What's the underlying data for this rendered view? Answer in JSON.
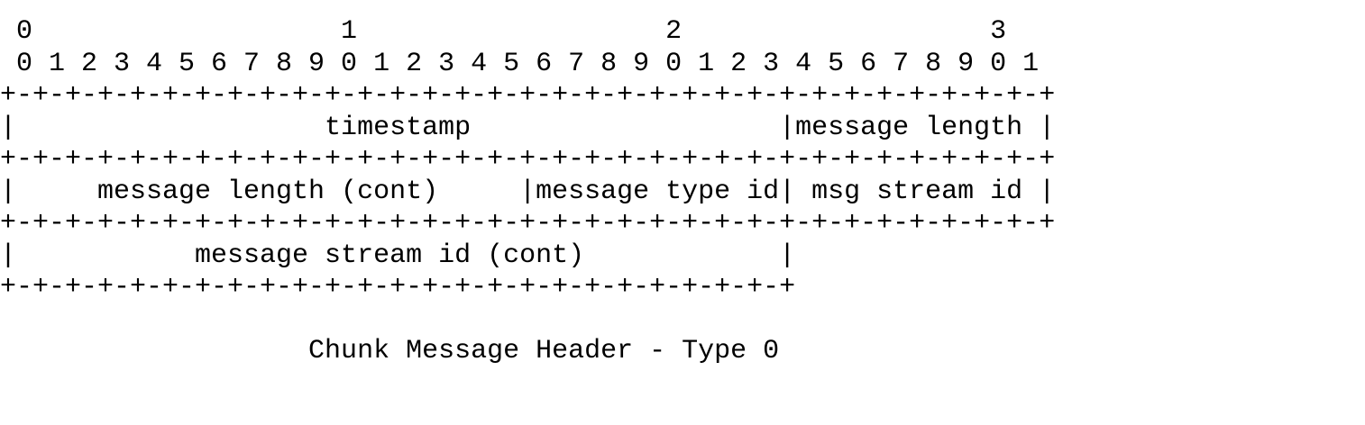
{
  "diagram": {
    "bit_tens": " 0                   1                   2                   3",
    "bit_ones": " 0 1 2 3 4 5 6 7 8 9 0 1 2 3 4 5 6 7 8 9 0 1 2 3 4 5 6 7 8 9 0 1",
    "border_full": "+-+-+-+-+-+-+-+-+-+-+-+-+-+-+-+-+-+-+-+-+-+-+-+-+-+-+-+-+-+-+-+-+",
    "row1": "|                   timestamp                   |message length |",
    "row2": "|     message length (cont)     |message type id| msg stream id |",
    "row3": "|           message stream id (cont)            |",
    "border_partial": "+-+-+-+-+-+-+-+-+-+-+-+-+-+-+-+-+-+-+-+-+-+-+-+-+",
    "caption": "                   Chunk Message Header - Type 0"
  }
}
